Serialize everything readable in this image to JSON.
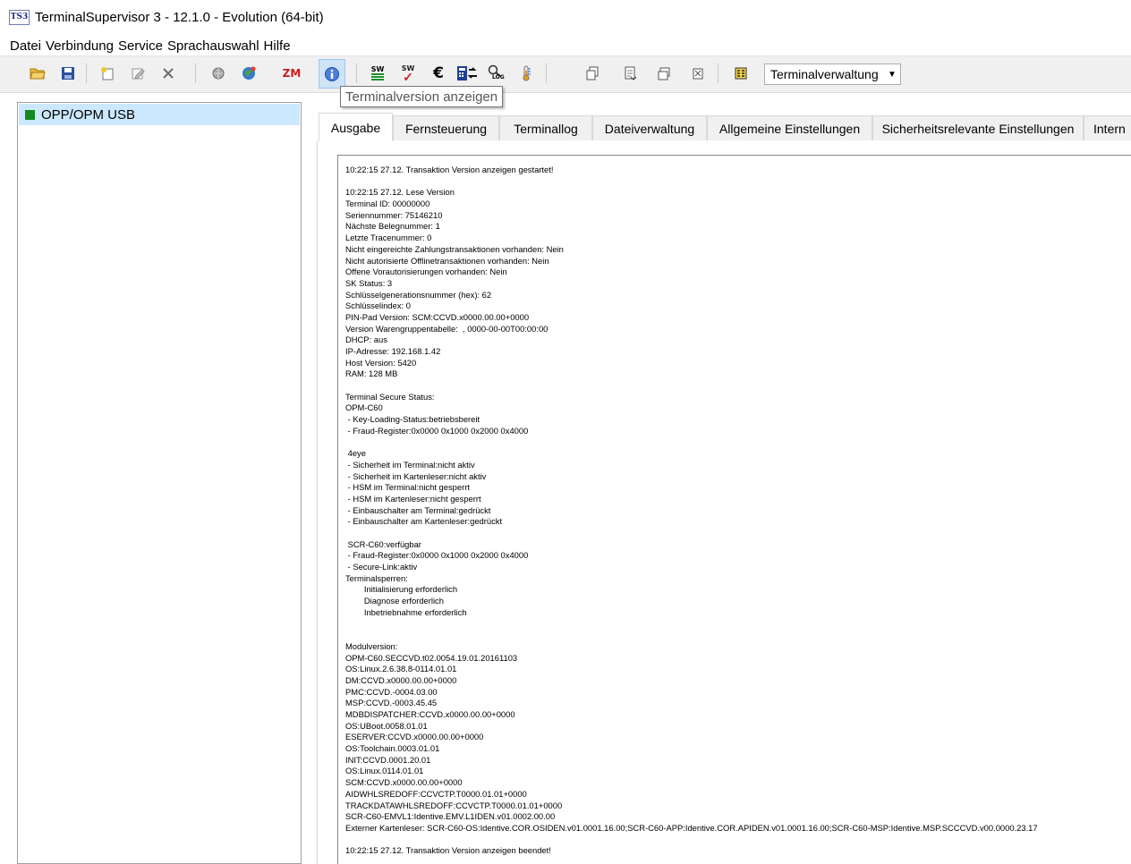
{
  "window": {
    "app_icon_text": "TS3",
    "title": "TerminalSupervisor 3 - 12.1.0 - Evolution (64-bit)"
  },
  "menu": [
    "Datei",
    "Verbindung",
    "Service",
    "Sprachauswahl",
    "Hilfe"
  ],
  "toolbar": {
    "buttons": [
      {
        "name": "open-folder-icon"
      },
      {
        "name": "save-icon"
      },
      {
        "name": "new-icon"
      },
      {
        "name": "edit-icon"
      },
      {
        "name": "delete-icon"
      },
      {
        "name": "connect-icon"
      },
      {
        "name": "globe-icon"
      },
      {
        "name": "zm-icon",
        "text": "ZM"
      },
      {
        "name": "info-icon",
        "active": true
      },
      {
        "name": "sw-download-icon",
        "text": "SW"
      },
      {
        "name": "sw-check-icon",
        "text": "SW"
      },
      {
        "name": "euro-icon",
        "text": "€"
      },
      {
        "name": "transfer-icon"
      },
      {
        "name": "log-icon",
        "text": "LOG"
      },
      {
        "name": "thermometer-icon"
      },
      {
        "name": "copy-icon"
      },
      {
        "name": "export-icon"
      },
      {
        "name": "window-icon"
      },
      {
        "name": "clear-icon"
      },
      {
        "name": "terminal-admin-icon"
      }
    ],
    "dropdown_value": "Terminalverwaltung",
    "tooltip": "Terminalversion anzeigen"
  },
  "sidebar": {
    "items": [
      {
        "label": "OPP/OPM USB",
        "status_color": "#138a1f"
      }
    ]
  },
  "tabs": [
    {
      "label": "Ausgabe",
      "active": true
    },
    {
      "label": "Fernsteuerung"
    },
    {
      "label": "Terminallog"
    },
    {
      "label": "Dateiverwaltung"
    },
    {
      "label": "Allgemeine Einstellungen"
    },
    {
      "label": "Sicherheitsrelevante Einstellungen"
    },
    {
      "label": "Intern"
    }
  ],
  "output": {
    "lines": [
      "10:22:15 27.12. Transaktion Version anzeigen gestartet!",
      "",
      "10:22:15 27.12. Lese Version",
      "Terminal ID: 00000000",
      "Seriennummer: 75146210",
      "Nächste Belegnummer: 1",
      "Letzte Tracenummer: 0",
      "Nicht eingereichte Zahlungstransaktionen vorhanden: Nein",
      "Nicht autorisierte Offlinetransaktionen vorhanden: Nein",
      "Offene Vorautorisierungen vorhanden: Nein",
      "SK Status: 3",
      "Schlüsselgenerationsnummer (hex): 62",
      "Schlüsselindex: 0",
      "PIN-Pad Version: SCM:CCVD.x0000.00.00+0000",
      "Version Warengruppentabelle:  , 0000-00-00T00:00:00",
      "DHCP: aus",
      "IP-Adresse: 192.168.1.42",
      "Host Version: 5420",
      "RAM: 128 MB",
      "",
      "Terminal Secure Status:",
      "OPM-C60",
      " - Key-Loading-Status:betriebsbereit",
      " - Fraud-Register:0x0000 0x1000 0x2000 0x4000",
      "",
      " 4eye",
      " - Sicherheit im Terminal:nicht aktiv",
      " - Sicherheit im Kartenleser:nicht aktiv",
      " - HSM im Terminal:nicht gesperrt",
      " - HSM im Kartenleser:nicht gesperrt",
      " - Einbauschalter am Terminal:gedrückt",
      " - Einbauschalter am Kartenleser:gedrückt",
      "",
      " SCR-C60:verfügbar",
      " - Fraud-Register:0x0000 0x1000 0x2000 0x4000",
      " - Secure-Link:aktiv",
      "Terminalsperren:",
      "        Initialisierung erforderlich",
      "        Diagnose erforderlich",
      "        Inbetriebnahme erforderlich",
      "",
      "",
      "Modulversion:",
      "OPM-C60.SECCVD.t02.0054.19.01.20161103",
      "OS:Linux.2.6.38.8-0114.01.01",
      "DM:CCVD.x0000.00.00+0000",
      "PMC:CCVD.-0004.03.00",
      "MSP:CCVD.-0003.45.45",
      "MDBDISPATCHER:CCVD.x0000.00.00+0000",
      "OS:UBoot.0058.01.01",
      "ESERVER:CCVD.x0000.00.00+0000",
      "OS:Toolchain.0003.01.01",
      "INIT:CCVD.0001.20.01",
      "OS:Linux.0114.01.01",
      "SCM:CCVD.x0000.00.00+0000",
      "AIDWHLSREDOFF:CCVCTP.T0000.01.01+0000",
      "TRACKDATAWHLSREDOFF:CCVCTP.T0000.01.01+0000",
      "SCR-C60-EMVL1:Identive.EMV.L1IDEN.v01.0002.00.00",
      "Externer Kartenleser: SCR-C60-OS:Identive.COR.OSIDEN.v01.0001.16.00;SCR-C60-APP:Identive.COR.APIDEN.v01.0001.16.00;SCR-C60-MSP:Identive.MSP.SCCCVD.v00.0000.23.17",
      "",
      "10:22:15 27.12. Transaktion Version anzeigen beendet!"
    ]
  }
}
